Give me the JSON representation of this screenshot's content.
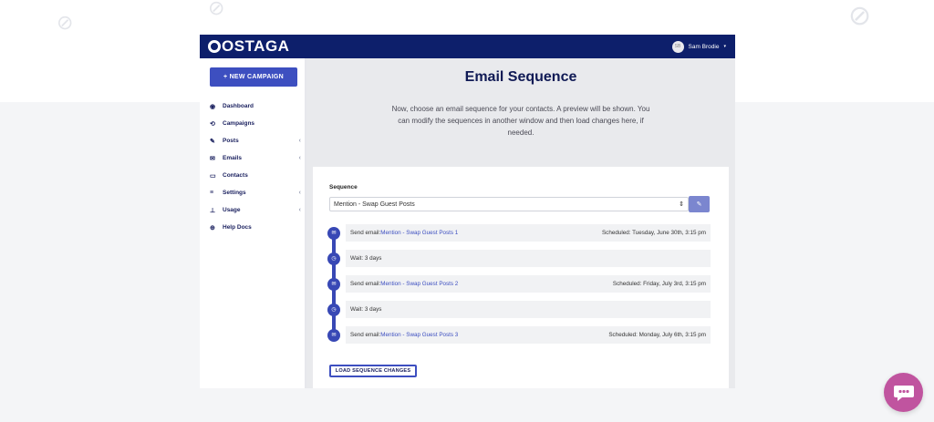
{
  "app": {
    "logo_text": "OSTAGA"
  },
  "user": {
    "initials": "SB",
    "name": "Sam Brodie",
    "menu_caret": "▾"
  },
  "sidebar": {
    "new_campaign_label": "+  NEW CAMPAIGN",
    "items": [
      {
        "label": "Dashboard",
        "icon": "dashboard-icon",
        "glyph": "◉",
        "chevron": ""
      },
      {
        "label": "Campaigns",
        "icon": "campaigns-icon",
        "glyph": "⟲",
        "chevron": ""
      },
      {
        "label": "Posts",
        "icon": "pencil-icon",
        "glyph": "✎",
        "chevron": "‹"
      },
      {
        "label": "Emails",
        "icon": "envelope-icon",
        "glyph": "✉",
        "chevron": "‹"
      },
      {
        "label": "Contacts",
        "icon": "contacts-icon",
        "glyph": "▭",
        "chevron": ""
      },
      {
        "label": "Settings",
        "icon": "sliders-icon",
        "glyph": "≡",
        "chevron": "‹"
      },
      {
        "label": "Usage",
        "icon": "usage-icon",
        "glyph": "⊥",
        "chevron": "‹"
      },
      {
        "label": "Help Docs",
        "icon": "help-icon",
        "glyph": "⊕",
        "chevron": ""
      }
    ]
  },
  "main": {
    "title": "Email Sequence",
    "intro": "Now, choose an email sequence for your contacts. A preview will be shown. You can modify the sequences in another window and then load changes here, if needed.",
    "sequence_label": "Sequence",
    "sequence_selected": "Mention - Swap Guest Posts",
    "select_arrows": "⇕",
    "edit_glyph": "✎",
    "steps": [
      {
        "type": "email",
        "prefix": "Send email:",
        "link": "Mention - Swap Guest Posts 1",
        "scheduled": "Scheduled: Tuesday, June 30th, 3:15 pm",
        "glyph": "✉"
      },
      {
        "type": "wait",
        "text": "Wait: 3 days",
        "glyph": "◷"
      },
      {
        "type": "email",
        "prefix": "Send email:",
        "link": "Mention - Swap Guest Posts 2",
        "scheduled": "Scheduled: Friday, July 3rd, 3:15 pm",
        "glyph": "✉"
      },
      {
        "type": "wait",
        "text": "Wait: 3 days",
        "glyph": "◷"
      },
      {
        "type": "email",
        "prefix": "Send email:",
        "link": "Mention - Swap Guest Posts 3",
        "scheduled": "Scheduled: Monday, July 6th, 3:15 pm",
        "glyph": "✉"
      }
    ],
    "load_button": "LOAD SEQUENCE CHANGES"
  },
  "colors": {
    "topbar": "#0d1f6b",
    "accent": "#3d4fc0",
    "chat": "#c0549f"
  }
}
